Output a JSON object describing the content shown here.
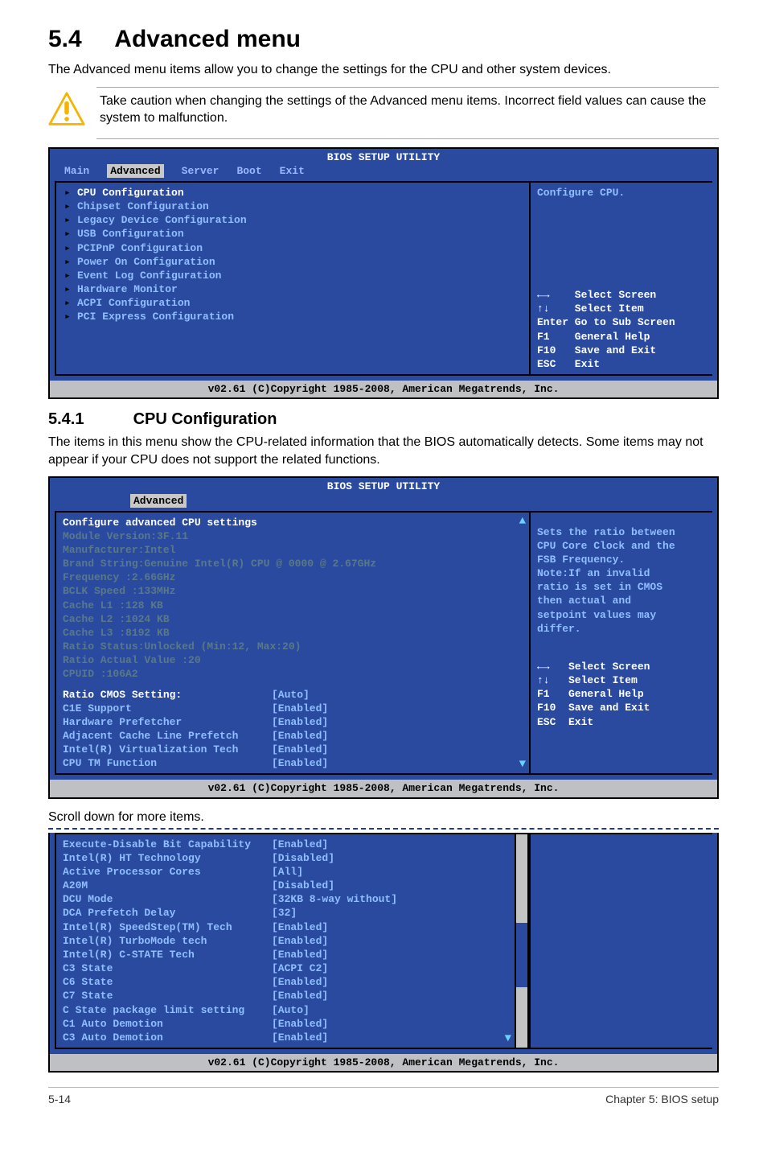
{
  "page": {
    "section_number": "5.4",
    "section_title": "Advanced menu",
    "lead": "The Advanced menu items allow you to change the settings for the CPU and other system devices.",
    "caution": "Take caution when changing the settings of the Advanced menu items. Incorrect field values can cause the system to malfunction.",
    "subsection_number": "5.4.1",
    "subsection_title": "CPU Configuration",
    "subsection_lead": "The items in this menu show the CPU-related information that the BIOS automatically detects. Some items may not appear if your CPU does not support the related functions.",
    "scroll_note": "Scroll down for more items.",
    "footer_left": "5-14",
    "footer_right": "Chapter 5: BIOS setup"
  },
  "bios1": {
    "title": "BIOS SETUP UTILITY",
    "tabs": [
      "Main",
      "Advanced",
      "Server",
      "Boot",
      "Exit"
    ],
    "active_tab": 1,
    "items": [
      "CPU Configuration",
      "Chipset Configuration",
      "Legacy Device Configuration",
      "USB Configuration",
      "PCIPnP Configuration",
      "Power On Configuration",
      "Event Log Configuration",
      "Hardware Monitor",
      "ACPI Configuration",
      "PCI Express Configuration"
    ],
    "help_header": "Configure CPU.",
    "help_keys": [
      "←→    Select Screen",
      "↑↓    Select Item",
      "Enter Go to Sub Screen",
      "F1    General Help",
      "F10   Save and Exit",
      "ESC   Exit"
    ],
    "footer": "v02.61 (C)Copyright 1985-2008, American Megatrends, Inc."
  },
  "bios2": {
    "title": "BIOS SETUP UTILITY",
    "tab_label": "Advanced",
    "heading": "Configure advanced CPU settings",
    "module": "Module Version:3F.11",
    "info": [
      "Manufacturer:Intel",
      "Brand String:Genuine Intel(R) CPU @ 0000 @ 2.67GHz",
      "Frequency   :2.66GHz",
      "BCLK Speed  :133MHz",
      "Cache L1    :128 KB",
      "Cache L2    :1024 KB",
      "Cache L3    :8192 KB",
      "Ratio Status:Unlocked (Min:12, Max:20)",
      "Ratio Actual Value  :20",
      "CPUID       :106A2"
    ],
    "settings": [
      {
        "label": "  Ratio CMOS Setting:",
        "value": "[Auto]"
      },
      {
        "label": "C1E Support",
        "value": "[Enabled]"
      },
      {
        "label": "Hardware Prefetcher",
        "value": "[Enabled]"
      },
      {
        "label": "Adjacent Cache Line Prefetch",
        "value": "[Enabled]"
      },
      {
        "label": "Intel(R) Virtualization Tech",
        "value": "[Enabled]"
      },
      {
        "label": "CPU TM Function",
        "value": "[Enabled]"
      }
    ],
    "help_block": [
      "Sets the ratio between",
      "CPU Core Clock and the",
      "FSB Frequency.",
      "Note:If an invalid",
      "ratio is set in CMOS",
      "then actual and",
      "setpoint values may",
      "differ."
    ],
    "help_keys": [
      "←→   Select Screen",
      "↑↓   Select Item",
      "F1   General Help",
      "F10  Save and Exit",
      "ESC  Exit"
    ],
    "footer": "v02.61 (C)Copyright 1985-2008, American Megatrends, Inc."
  },
  "bios3": {
    "settings": [
      {
        "label": "Execute-Disable Bit Capability",
        "value": "[Enabled]"
      },
      {
        "label": "Intel(R) HT Technology",
        "value": "[Disabled]"
      },
      {
        "label": "Active Processor Cores",
        "value": "[All]"
      },
      {
        "label": "A20M",
        "value": "[Disabled]"
      },
      {
        "label": "DCU Mode",
        "value": "[32KB 8-way without]"
      },
      {
        "label": "DCA Prefetch Delay",
        "value": "[32]"
      },
      {
        "label": "Intel(R) SpeedStep(TM) Tech",
        "value": "[Enabled]"
      },
      {
        "label": "Intel(R) TurboMode tech",
        "value": "[Enabled]"
      },
      {
        "label": "Intel(R) C-STATE Tech",
        "value": "[Enabled]"
      },
      {
        "label": "C3 State",
        "value": "[ACPI C2]"
      },
      {
        "label": "C6 State",
        "value": "[Enabled]"
      },
      {
        "label": "C7 State",
        "value": "[Enabled]"
      },
      {
        "label": "C State package limit setting",
        "value": "[Auto]"
      },
      {
        "label": "C1 Auto Demotion",
        "value": "[Enabled]"
      },
      {
        "label": "C3 Auto Demotion",
        "value": "[Enabled]"
      }
    ],
    "footer": "v02.61 (C)Copyright 1985-2008, American Megatrends, Inc."
  }
}
